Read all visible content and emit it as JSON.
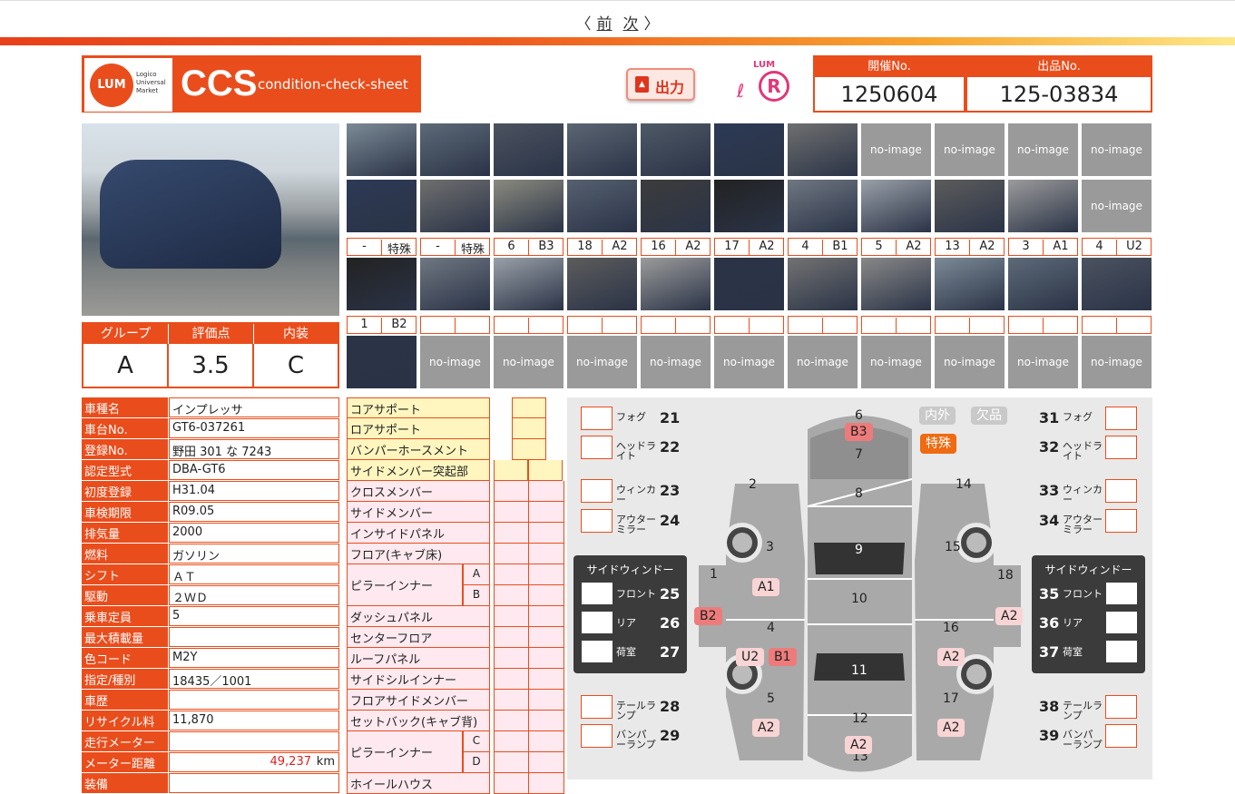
{
  "nav": {
    "prev": "前",
    "next": "次"
  },
  "logo": {
    "mark": "LUM",
    "subtitle": "Logico Universal Market",
    "ccs": "CCS",
    "tagline": "condition-check-sheet"
  },
  "output_button": "出力",
  "output_icon": "pdf-icon",
  "lumr": {
    "top": "LUM",
    "letter": "R"
  },
  "header": {
    "session_label": "開催No.",
    "session_value": "1250604",
    "lot_label": "出品No.",
    "lot_value": "125-03834"
  },
  "photos": {
    "noimage": "no-image"
  },
  "damage_labels_row3": [
    [
      "-",
      "特殊"
    ],
    [
      "-",
      "特殊"
    ],
    [
      "6",
      "B3"
    ],
    [
      "18",
      "A2"
    ],
    [
      "16",
      "A2"
    ],
    [
      "17",
      "A2"
    ],
    [
      "4",
      "B1"
    ],
    [
      "5",
      "A2"
    ],
    [
      "13",
      "A2"
    ],
    [
      "3",
      "A1"
    ],
    [
      "4",
      "U2"
    ]
  ],
  "damage_labels_row4": [
    [
      "1",
      "B2"
    ]
  ],
  "grade": {
    "group_label": "グループ",
    "group_value": "A",
    "score_label": "評価点",
    "score_value": "3.5",
    "interior_label": "内装",
    "interior_value": "C"
  },
  "spec": [
    {
      "k": "車種名",
      "v": "インプレッサ"
    },
    {
      "k": "車台No.",
      "v": "GT6-037261"
    },
    {
      "k": "登録No.",
      "v": "野田 301 な 7243"
    },
    {
      "k": "認定型式",
      "v": "DBA-GT6"
    },
    {
      "k": "初度登録",
      "v": "H31.04"
    },
    {
      "k": "車検期限",
      "v": "R09.05"
    },
    {
      "k": "排気量",
      "v": "2000"
    },
    {
      "k": "燃料",
      "v": "ガソリン"
    },
    {
      "k": "シフト",
      "v": "ＡＴ"
    },
    {
      "k": "駆動",
      "v": "２ＷＤ"
    },
    {
      "k": "乗車定員",
      "v": "5"
    },
    {
      "k": "最大積載量",
      "v": ""
    },
    {
      "k": "色コード",
      "v": "M2Y"
    },
    {
      "k": "指定/種別",
      "v": "18435／1001"
    },
    {
      "k": "車歴",
      "v": ""
    },
    {
      "k": "リサイクル料",
      "v": "11,870"
    },
    {
      "k": "走行メーター",
      "v": ""
    },
    {
      "k": "メーター距離",
      "v": "49,237",
      "unit": "km"
    },
    {
      "k": "装備",
      "v": ""
    }
  ],
  "parts": [
    "コアサポート",
    "ロアサポート",
    "バンパーホースメント",
    "サイドメンバー突起部",
    "クロスメンバー",
    "サイドメンバー",
    "インサイドパネル",
    "フロア(キャブ床)",
    "ピラーインナー",
    "",
    "ダッシュパネル",
    "センターフロア",
    "ルーフパネル",
    "サイドシルインナー",
    "フロアサイドメンバー",
    "セットバック(キャブ背)",
    "ピラーインナー",
    "",
    "ホイールハウス"
  ],
  "parts_sub": {
    "a": "A",
    "b": "B",
    "c": "C",
    "d": "D"
  },
  "diagram": {
    "left_items": [
      {
        "n": "21",
        "l": "フォグ"
      },
      {
        "n": "22",
        "l": "ヘッドライト"
      },
      {
        "n": "23",
        "l": "ウィンカー"
      },
      {
        "n": "24",
        "l": "アウターミラー"
      },
      {
        "n": "28",
        "l": "テールランプ"
      },
      {
        "n": "29",
        "l": "バンパーランプ"
      }
    ],
    "right_items": [
      {
        "n": "31",
        "l": "フォグ"
      },
      {
        "n": "32",
        "l": "ヘッドライト"
      },
      {
        "n": "33",
        "l": "ウィンカー"
      },
      {
        "n": "34",
        "l": "アウターミラー"
      },
      {
        "n": "38",
        "l": "テールランプ"
      },
      {
        "n": "39",
        "l": "バンパーランプ"
      }
    ],
    "side_window_title": "サイドウィンドー",
    "left_win": [
      {
        "n": "25",
        "l": "フロント"
      },
      {
        "n": "26",
        "l": "リア"
      },
      {
        "n": "27",
        "l": "荷室"
      }
    ],
    "right_win": [
      {
        "n": "35",
        "l": "フロント"
      },
      {
        "n": "36",
        "l": "リア"
      },
      {
        "n": "37",
        "l": "荷室"
      }
    ],
    "tags": {
      "interior": "内外",
      "missing": "欠品",
      "special": "特殊"
    },
    "panel_nums": [
      "6",
      "7",
      "8",
      "9",
      "10",
      "11",
      "12",
      "13",
      "2",
      "3",
      "1",
      "4",
      "5",
      "14",
      "15",
      "18",
      "16",
      "17"
    ],
    "badges": [
      "B3",
      "A1",
      "B2",
      "U2",
      "B1",
      "A2",
      "A2",
      "A2",
      "A2",
      "A2"
    ]
  }
}
